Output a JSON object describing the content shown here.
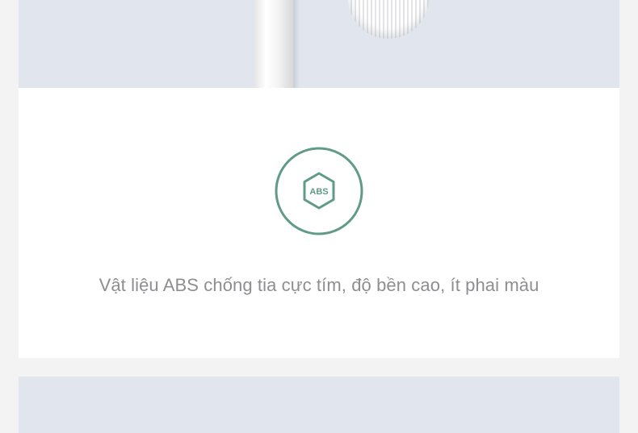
{
  "feature": {
    "icon_label": "ABS",
    "caption": "Vật liệu ABS chống tia cực tím, độ bền cao, ít phai màu",
    "accent_color": "#5f9b85",
    "text_color": "#8e8e92"
  },
  "icons": {
    "feature_icon": "abs-hexagon-icon"
  }
}
